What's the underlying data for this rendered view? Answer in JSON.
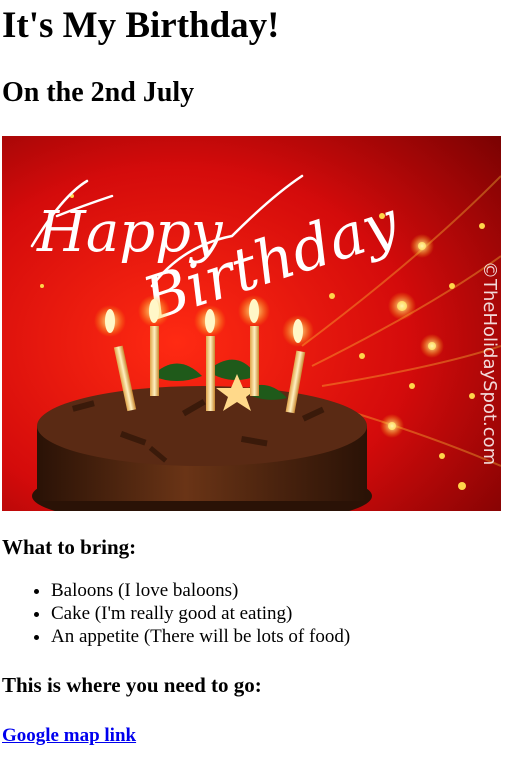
{
  "title": "It's My Birthday!",
  "subtitle": "On the 2nd July",
  "banner": {
    "script_line1": "Happy",
    "script_line2": "Birthday",
    "watermark": "©TheHolidaySpot.com",
    "colors": {
      "red": "#d40b0b",
      "dark_red": "#7a0202",
      "gold": "#ffd54a",
      "cake": "#5a2a14"
    }
  },
  "bring": {
    "heading": "What to bring:",
    "items": [
      "Baloons (I love baloons)",
      "Cake (I'm really good at eating)",
      "An appetite (There will be lots of food)"
    ]
  },
  "go": {
    "heading": "This is where you need to go:",
    "link_text": "Google map link"
  }
}
